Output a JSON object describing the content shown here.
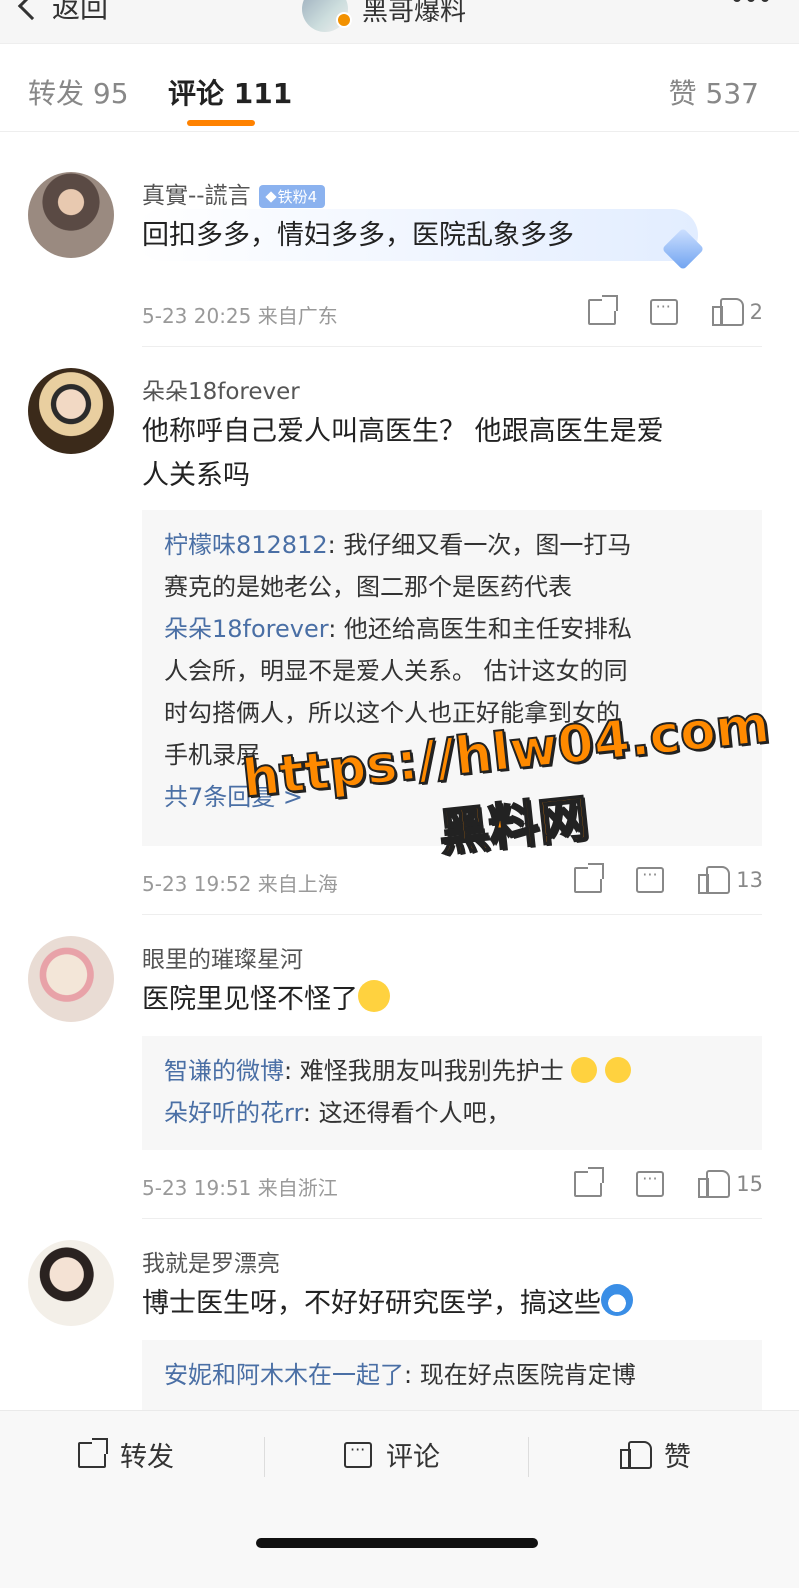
{
  "nav": {
    "back_label": "返回",
    "title": "黑哥爆料"
  },
  "tabs": {
    "repost": "转发 95",
    "comments": "评论 111",
    "likes": "赞 537"
  },
  "comments": [
    {
      "name": "真實--謊言",
      "badge": "铁粉4",
      "text": "回扣多多，情妇多多，医院乱象多多",
      "meta": "5-23 20:25 来自广东",
      "likes": "2"
    },
    {
      "name": "朵朵18forever",
      "text_line1": "他称呼自己爱人叫高医生？ 他跟高医生是爱",
      "text_line2": "人关系吗",
      "replies": [
        {
          "who": "柠檬味812812",
          "text_line1": ": 我仔细又看一次，图一打马",
          "text_line2": "赛克的是她老公，图二那个是医药代表"
        },
        {
          "who": "朵朵18forever",
          "text_line1": ": 他还给高医生和主任安排私",
          "text_line2": "人会所，明显不是爱人关系。 估计这女的同",
          "text_line3": "时勾搭俩人，所以这个人也正好能拿到女的",
          "text_line4": "手机录屏"
        }
      ],
      "more_replies": "共7条回复 >",
      "meta": "5-23 19:52 来自上海",
      "likes": "13"
    },
    {
      "name": "眼里的璀璨星河",
      "text": "医院里见怪不怪了",
      "replies": [
        {
          "who": "智谦的微博",
          "text": ": 难怪我朋友叫我别先护士"
        },
        {
          "who": "朵好听的花rr",
          "text": ": 这还得看个人吧，"
        }
      ],
      "meta": "5-23 19:51 来自浙江",
      "likes": "15"
    },
    {
      "name": "我就是罗漂亮",
      "text": "博士医生呀，不好好研究医学，搞这些",
      "replies": [
        {
          "who": "安妮和阿木木在一起了",
          "text": ": 现在好点医院肯定博"
        }
      ]
    }
  ],
  "watermark": {
    "url": "https://hlw04.com",
    "name": "黑料网"
  },
  "bottom_bar": {
    "repost": "转发",
    "comment": "评论",
    "like": "赞"
  },
  "icons": {
    "back": "chevron-left-icon",
    "more": "more-dots-icon",
    "share": "share-icon",
    "comment": "comment-icon",
    "like": "thumbs-up-icon"
  },
  "colors": {
    "accent": "#ff8200",
    "link": "#4a6fa5",
    "badge": "#8bb2ef",
    "watermark": "#ff8a00"
  }
}
